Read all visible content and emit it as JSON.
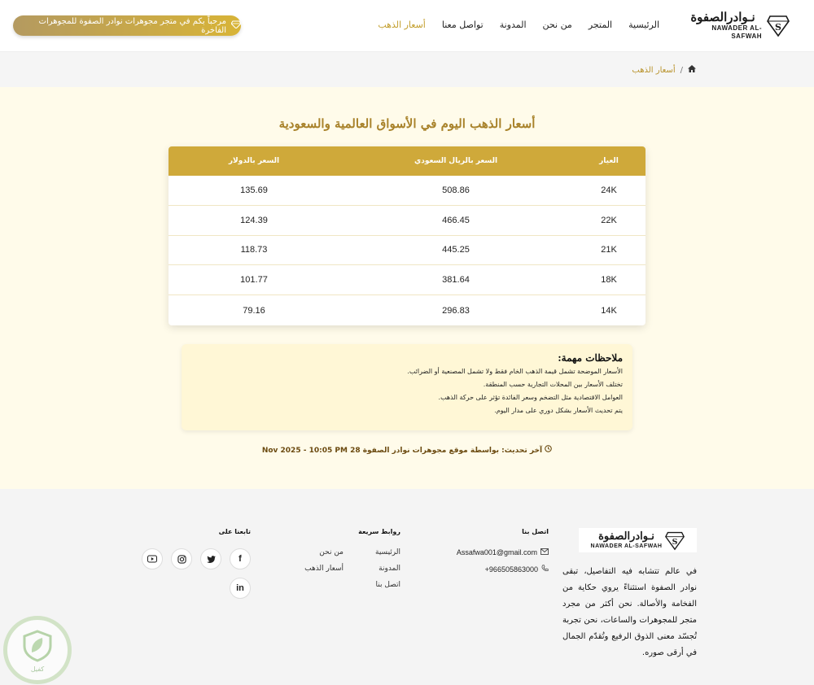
{
  "header": {
    "logo_ar": "نـوادرالصفوة",
    "logo_en": "NAWADER AL-SAFWAH",
    "nav": [
      "الرئيسية",
      "المتجر",
      "من نحن",
      "المدونة",
      "تواصل معنا",
      "أسعار الذهب"
    ],
    "welcome": "مرحباً بكم في متجر مجوهرات نوادر الصفوة للمجوهرات الفاخرة"
  },
  "breadcrumb": {
    "separator": "/",
    "current": "أسعار الذهب"
  },
  "main": {
    "title": "أسعار الذهب اليوم في الأسواق العالمية والسعودية",
    "table": {
      "headers": [
        "العيار",
        "السعر بالريال السعودي",
        "السعر بالدولار"
      ],
      "rows": [
        [
          "24K",
          "508.86",
          "135.69"
        ],
        [
          "22K",
          "466.45",
          "124.39"
        ],
        [
          "21K",
          "445.25",
          "118.73"
        ],
        [
          "18K",
          "381.64",
          "101.77"
        ],
        [
          "14K",
          "296.83",
          "79.16"
        ]
      ]
    },
    "notes": {
      "title": "ملاحظات مهمة:",
      "items": [
        "الأسعار الموضحة تشمل قيمة الذهب الخام فقط ولا تشمل المصنعية أو الضرائب.",
        "تختلف الأسعار بين المحلات التجارية حسب المنطقة.",
        "العوامل الاقتصادية مثل التضخم وسعر الفائدة تؤثر على حركة الذهب.",
        "يتم تحديث الأسعار بشكل دوري على مدار اليوم."
      ]
    },
    "updated": "آخر تحديث: بواسطة موقع مجوهرات نوادر الصفوة 28 Nov 2025 - 10:05 PM"
  },
  "footer": {
    "about": "في عالم تتشابه فيه التفاصيل، تبقى نوادر الصفوة استثناءً يروي حكاية من الفخامة والأصالة. نحن أكثر من مجرد متجر للمجوهرات والساعات، نحن تجربة تُجسّد معنى الذوق الرفيع وتُقدّم الجمال في أرقى صوره.",
    "contact_title": "اتصل بنا",
    "email": "Assafwa001@gmail.com",
    "phone": "+966505863000",
    "links_title": "روابط سريعة",
    "links": [
      "الرئيسية",
      "من نحن",
      "المدونة",
      "أسعار الذهب",
      "اتصل بنا"
    ],
    "follow_title": "تابعنا على",
    "badge": "كفيل"
  }
}
